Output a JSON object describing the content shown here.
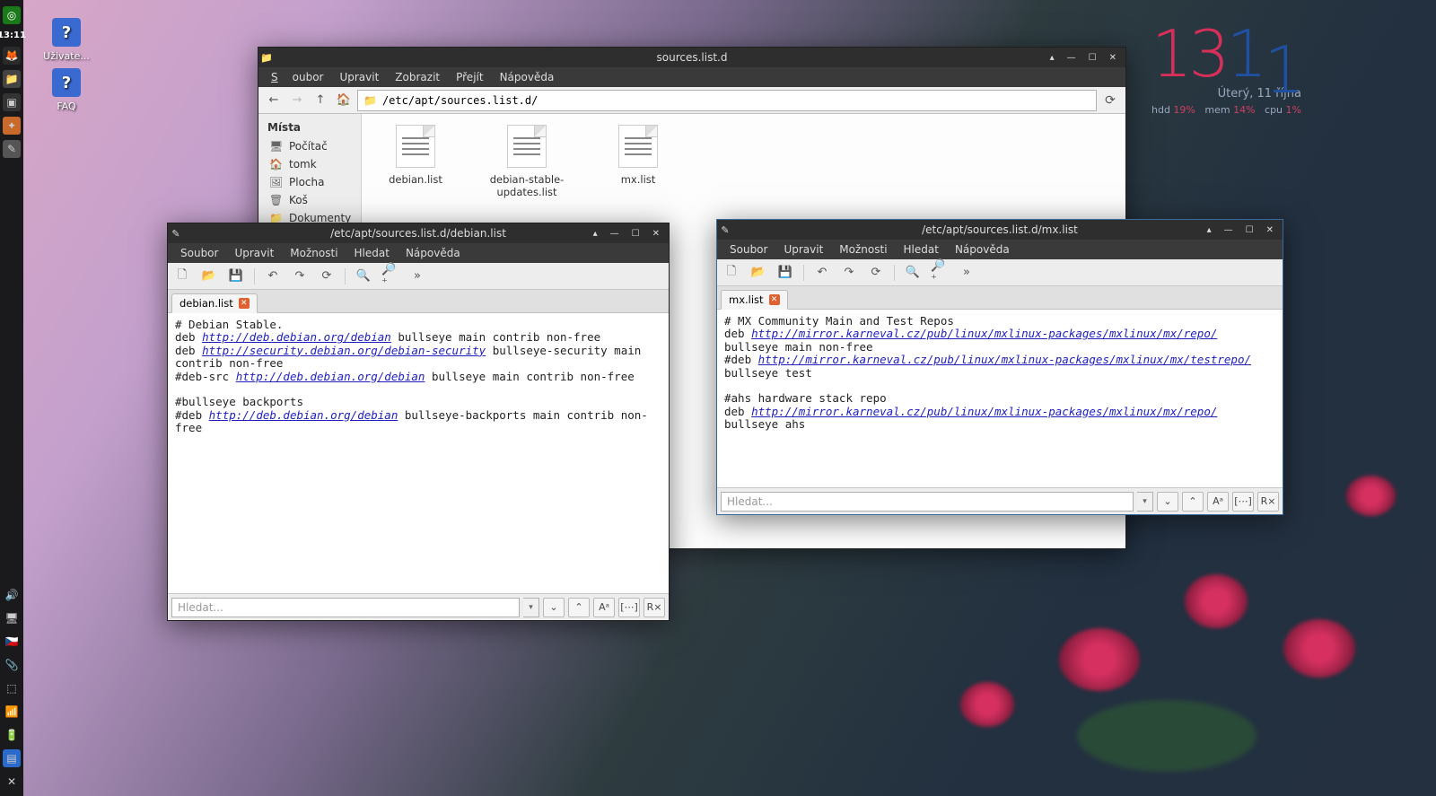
{
  "taskbar": {
    "time": "13:11"
  },
  "conky": {
    "hour": "13",
    "minute_tens": "1",
    "minute_units": "1",
    "date": "Úterý, 11 října",
    "hdd_label": "hdd",
    "hdd_val": "19%",
    "mem_label": "mem",
    "mem_val": "14%",
    "cpu_label": "cpu",
    "cpu_val": "1%"
  },
  "desktop": {
    "icons": [
      {
        "label": "Uživate..."
      },
      {
        "label": "FAQ"
      }
    ]
  },
  "filemanager": {
    "title": "sources.list.d",
    "menu": [
      "Soubor",
      "Upravit",
      "Zobrazit",
      "Přejít",
      "Nápověda"
    ],
    "path": "/etc/apt/sources.list.d/",
    "sidebar_header": "Místa",
    "sidebar": [
      {
        "icon": "🖥",
        "label": "Počítač"
      },
      {
        "icon": "🏠",
        "label": "tomk"
      },
      {
        "icon": "🖼",
        "label": "Plocha"
      },
      {
        "icon": "🗑",
        "label": "Koš"
      },
      {
        "icon": "📁",
        "label": "Dokumenty"
      }
    ],
    "files": [
      {
        "label": "debian.list"
      },
      {
        "label": "debian-stable-updates.list"
      },
      {
        "label": "mx.list"
      }
    ]
  },
  "editor1": {
    "title": "/etc/apt/sources.list.d/debian.list",
    "menu": [
      "Soubor",
      "Upravit",
      "Možnosti",
      "Hledat",
      "Nápověda"
    ],
    "tab": "debian.list",
    "search_placeholder": "Hledat...",
    "content": {
      "l1": "# Debian Stable.",
      "l2a": "deb ",
      "l2u": "http://deb.debian.org/debian",
      "l2b": " bullseye main contrib non-free",
      "l3a": "deb ",
      "l3u": "http://security.debian.org/debian-security",
      "l3b": " bullseye-security main contrib non-free",
      "l4a": "#deb-src ",
      "l4u": "http://deb.debian.org/debian",
      "l4b": " bullseye main contrib non-free",
      "l5": "",
      "l6": "#bullseye backports",
      "l7a": "#deb ",
      "l7u": "http://deb.debian.org/debian",
      "l7b": " bullseye-backports main contrib non-free"
    }
  },
  "editor2": {
    "title": "/etc/apt/sources.list.d/mx.list",
    "menu": [
      "Soubor",
      "Upravit",
      "Možnosti",
      "Hledat",
      "Nápověda"
    ],
    "tab": "mx.list",
    "search_placeholder": "Hledat...",
    "content": {
      "l1": "# MX Community Main and Test Repos",
      "l2a": "deb ",
      "l2u": "http://mirror.karneval.cz/pub/linux/mxlinux-packages/mxlinux/mx/repo/",
      "l2b": " bullseye main non-free",
      "l3a": "#deb ",
      "l3u": "http://mirror.karneval.cz/pub/linux/mxlinux-packages/mxlinux/mx/testrepo/",
      "l3b": " bullseye test",
      "l4": "",
      "l5": "#ahs hardware stack repo",
      "l6a": "deb ",
      "l6u": "http://mirror.karneval.cz/pub/linux/mxlinux-packages/mxlinux/mx/repo/",
      "l6b": " bullseye ahs"
    }
  }
}
